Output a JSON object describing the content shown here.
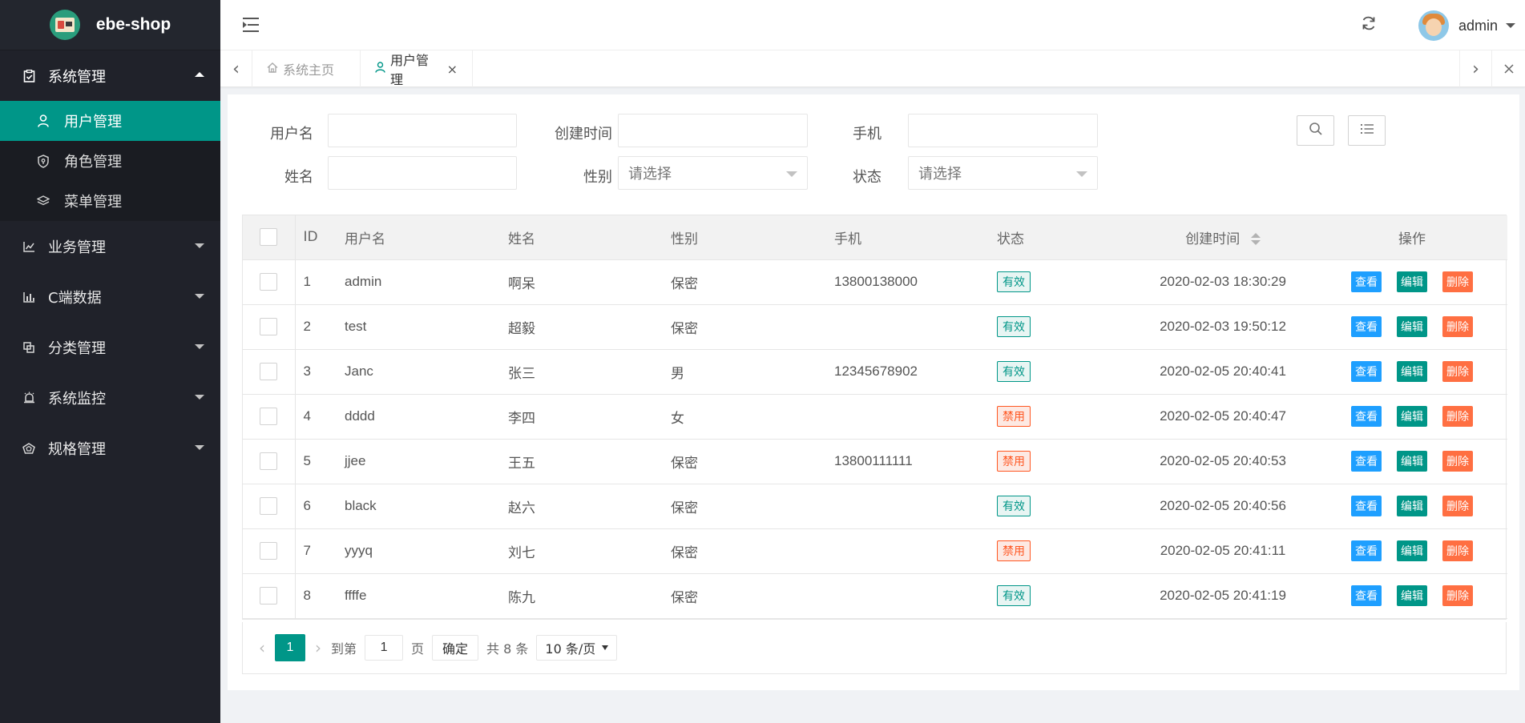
{
  "app": {
    "title": "ebe-shop"
  },
  "sidebar": {
    "groups": [
      {
        "label": "系统管理",
        "icon": "clipboard-icon",
        "open": true,
        "children": [
          {
            "label": "用户管理",
            "icon": "user-icon",
            "active": true
          },
          {
            "label": "角色管理",
            "icon": "shield-icon"
          },
          {
            "label": "菜单管理",
            "icon": "layers-icon"
          }
        ]
      },
      {
        "label": "业务管理",
        "icon": "chart-icon"
      },
      {
        "label": "C端数据",
        "icon": "bar-chart-icon"
      },
      {
        "label": "分类管理",
        "icon": "copy-icon"
      },
      {
        "label": "系统监控",
        "icon": "alarm-icon"
      },
      {
        "label": "规格管理",
        "icon": "gem-icon"
      }
    ]
  },
  "header": {
    "username": "admin"
  },
  "tabs": [
    {
      "label": "系统主页",
      "icon": "home-icon"
    },
    {
      "label": "用户管理",
      "icon": "user-icon",
      "active": true,
      "close": "×"
    }
  ],
  "filters": {
    "username_label": "用户名",
    "created_label": "创建时间",
    "phone_label": "手机",
    "name_label": "姓名",
    "gender_label": "性别",
    "status_label": "状态",
    "gender_value": "请选择",
    "status_value": "请选择"
  },
  "table": {
    "headers": [
      "ID",
      "用户名",
      "姓名",
      "性别",
      "手机",
      "状态",
      "创建时间",
      "操作"
    ],
    "rows": [
      {
        "id": "1",
        "username": "admin",
        "name": "啊呆",
        "gender": "保密",
        "phone": "13800138000",
        "status": "有效",
        "created": "2020-02-03 18:30:29"
      },
      {
        "id": "2",
        "username": "test",
        "name": "超毅",
        "gender": "保密",
        "phone": "",
        "status": "有效",
        "created": "2020-02-03 19:50:12"
      },
      {
        "id": "3",
        "username": "Janc",
        "name": "张三",
        "gender": "男",
        "phone": "12345678902",
        "status": "有效",
        "created": "2020-02-05 20:40:41"
      },
      {
        "id": "4",
        "username": "dddd",
        "name": "李四",
        "gender": "女",
        "phone": "",
        "status": "禁用",
        "created": "2020-02-05 20:40:47"
      },
      {
        "id": "5",
        "username": "jjee",
        "name": "王五",
        "gender": "保密",
        "phone": "13800111111",
        "status": "禁用",
        "created": "2020-02-05 20:40:53"
      },
      {
        "id": "6",
        "username": "black",
        "name": "赵六",
        "gender": "保密",
        "phone": "",
        "status": "有效",
        "created": "2020-02-05 20:40:56"
      },
      {
        "id": "7",
        "username": "yyyq",
        "name": "刘七",
        "gender": "保密",
        "phone": "",
        "status": "禁用",
        "created": "2020-02-05 20:41:11"
      },
      {
        "id": "8",
        "username": "ffffe",
        "name": "陈九",
        "gender": "保密",
        "phone": "",
        "status": "有效",
        "created": "2020-02-05 20:41:19"
      }
    ],
    "actions": {
      "view": "查看",
      "edit": "编辑",
      "delete": "删除"
    }
  },
  "pagination": {
    "current": "1",
    "goto_label": "到第",
    "goto_value": "1",
    "page_label": "页",
    "confirm": "确定",
    "total": "共 8 条",
    "page_size": "10 条/页"
  },
  "colors": {
    "accent": "#009688",
    "sidebar_bg": "#20222a",
    "view": "#1e9fff",
    "danger": "#ff5722"
  }
}
